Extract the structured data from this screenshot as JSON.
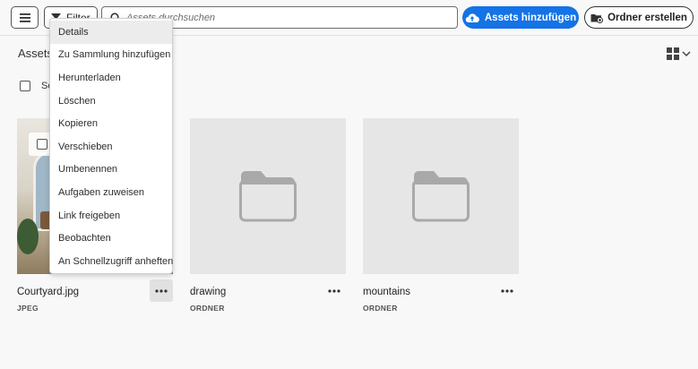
{
  "toolbar": {
    "filter_label": "Filter",
    "search_placeholder": "Assets durchsuchen",
    "add_assets_label": "Assets hinzufügen",
    "create_folder_label": "Ordner erstellen"
  },
  "breadcrumb": {
    "title": "Assets"
  },
  "selection": {
    "select_all_label": "Sc"
  },
  "colors": {
    "accent": "#1473e6",
    "folder": "#a9a9a9",
    "tile": "#e6e6e6"
  },
  "context_menu": {
    "items": [
      "Details",
      "Zu Sammlung hinzufügen",
      "Herunterladen",
      "Löschen",
      "Kopieren",
      "Verschieben",
      "Umbenennen",
      "Aufgaben zuweisen",
      "Link freigeben",
      "Beobachten",
      "An Schnellzugriff anheften"
    ]
  },
  "cards": [
    {
      "name": "Courtyard.jpg",
      "type": "JPEG",
      "icon": "image-thumbnail"
    },
    {
      "name": "drawing",
      "type": "ORDNER",
      "icon": "folder-icon"
    },
    {
      "name": "mountains",
      "type": "ORDNER",
      "icon": "folder-icon"
    }
  ]
}
